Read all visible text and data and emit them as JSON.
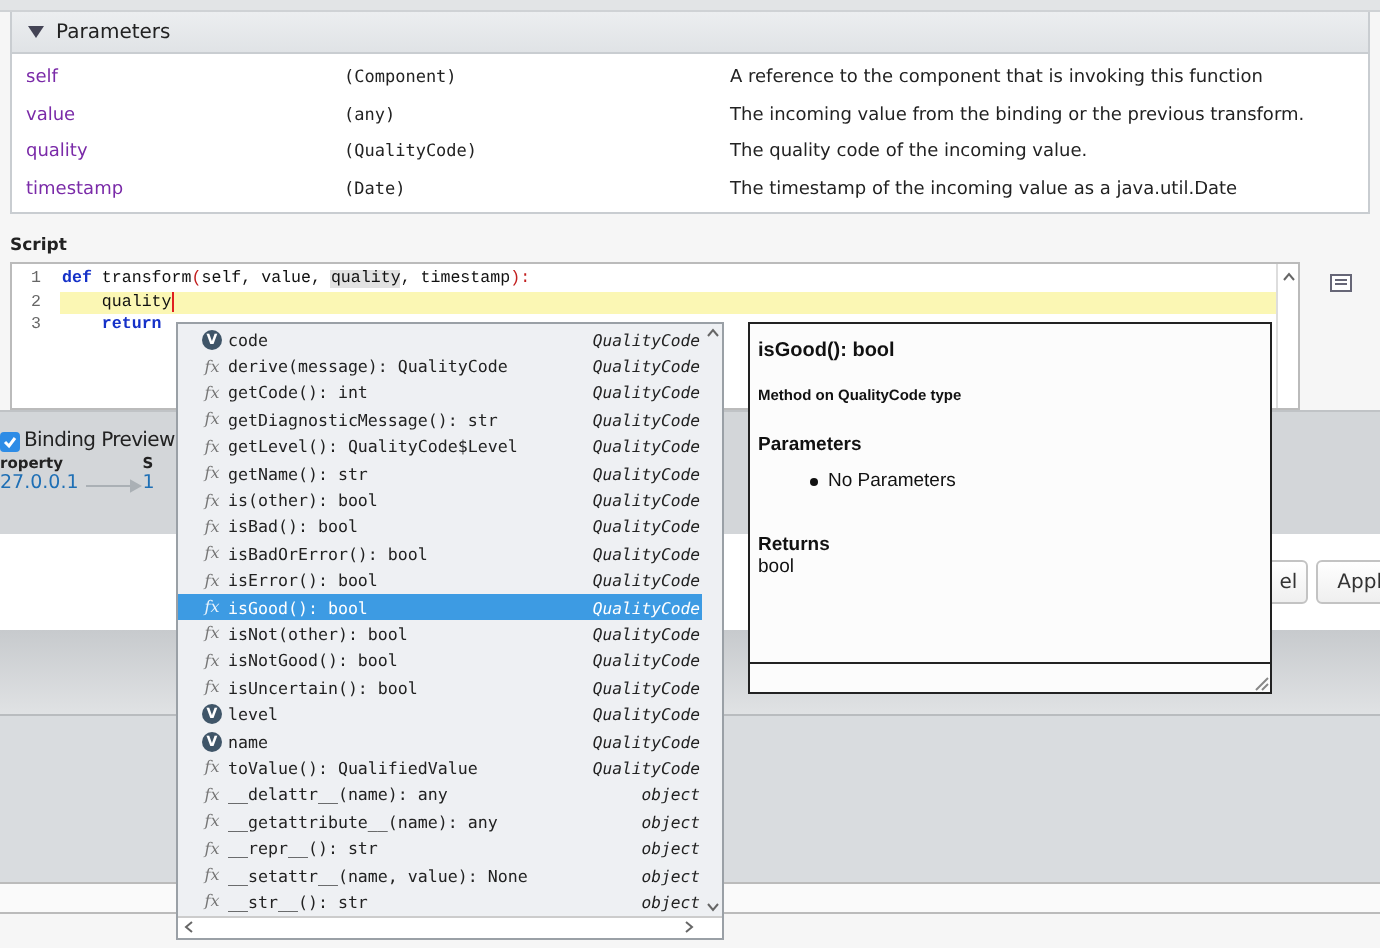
{
  "parameters": {
    "title": "Parameters",
    "expanded": true,
    "rows": [
      {
        "name": "self",
        "type": "(Component)",
        "description": "A reference to the component that is invoking this function"
      },
      {
        "name": "value",
        "type": "(any)",
        "description": "The incoming value from the binding or the previous transform."
      },
      {
        "name": "quality",
        "type": "(QualityCode)",
        "description": "The quality code of the incoming value."
      },
      {
        "name": "timestamp",
        "type": "(Date)",
        "description": "The timestamp of the incoming value as a java.util.Date"
      }
    ]
  },
  "script": {
    "label": "Script",
    "lines": [
      {
        "number": "1",
        "current": false,
        "tokens": [
          {
            "text": "def",
            "kind": "keyword"
          },
          {
            "text": " transform",
            "kind": "plain"
          },
          {
            "text": "(",
            "kind": "punct"
          },
          {
            "text": "self, value, ",
            "kind": "plain"
          },
          {
            "text": "quality",
            "kind": "occurrence"
          },
          {
            "text": ", timestamp",
            "kind": "plain"
          },
          {
            "text": "):",
            "kind": "punct"
          }
        ]
      },
      {
        "number": "2",
        "current": true,
        "tokens": [
          {
            "text": "    quality",
            "kind": "plain"
          }
        ]
      },
      {
        "number": "3",
        "current": false,
        "tokens": [
          {
            "text": "    return",
            "kind": "keyword"
          }
        ]
      }
    ]
  },
  "binding_preview": {
    "label": "Binding Preview",
    "checked": true,
    "column_1_label": "roperty",
    "column_1_value": "27.0.0.1",
    "column_2_label": "S",
    "column_2_value": "1"
  },
  "buttons": [
    "el",
    "Appl"
  ],
  "completion": {
    "items": [
      {
        "kind": "field",
        "icon": "V",
        "label": "code",
        "type": "QualityCode",
        "selected": false
      },
      {
        "kind": "method",
        "icon": "fx",
        "label": "derive(message): QualityCode",
        "type": "QualityCode",
        "selected": false
      },
      {
        "kind": "method",
        "icon": "fx",
        "label": "getCode(): int",
        "type": "QualityCode",
        "selected": false
      },
      {
        "kind": "method",
        "icon": "fx",
        "label": "getDiagnosticMessage(): str",
        "type": "QualityCode",
        "selected": false
      },
      {
        "kind": "method",
        "icon": "fx",
        "label": "getLevel(): QualityCode$Level",
        "type": "QualityCode",
        "selected": false
      },
      {
        "kind": "method",
        "icon": "fx",
        "label": "getName(): str",
        "type": "QualityCode",
        "selected": false
      },
      {
        "kind": "method",
        "icon": "fx",
        "label": "is(other): bool",
        "type": "QualityCode",
        "selected": false
      },
      {
        "kind": "method",
        "icon": "fx",
        "label": "isBad(): bool",
        "type": "QualityCode",
        "selected": false
      },
      {
        "kind": "method",
        "icon": "fx",
        "label": "isBadOrError(): bool",
        "type": "QualityCode",
        "selected": false
      },
      {
        "kind": "method",
        "icon": "fx",
        "label": "isError(): bool",
        "type": "QualityCode",
        "selected": false
      },
      {
        "kind": "method",
        "icon": "fx",
        "label": "isGood(): bool",
        "type": "QualityCode",
        "selected": true
      },
      {
        "kind": "method",
        "icon": "fx",
        "label": "isNot(other): bool",
        "type": "QualityCode",
        "selected": false
      },
      {
        "kind": "method",
        "icon": "fx",
        "label": "isNotGood(): bool",
        "type": "QualityCode",
        "selected": false
      },
      {
        "kind": "method",
        "icon": "fx",
        "label": "isUncertain(): bool",
        "type": "QualityCode",
        "selected": false
      },
      {
        "kind": "field",
        "icon": "V",
        "label": "level",
        "type": "QualityCode",
        "selected": false
      },
      {
        "kind": "field",
        "icon": "V",
        "label": "name",
        "type": "QualityCode",
        "selected": false
      },
      {
        "kind": "method",
        "icon": "fx",
        "label": "toValue(): QualifiedValue",
        "type": "QualityCode",
        "selected": false
      },
      {
        "kind": "method",
        "icon": "fx",
        "label": "__delattr__(name): any",
        "type": "object",
        "selected": false
      },
      {
        "kind": "method",
        "icon": "fx",
        "label": "__getattribute__(name): any",
        "type": "object",
        "selected": false
      },
      {
        "kind": "method",
        "icon": "fx",
        "label": "__repr__(): str",
        "type": "object",
        "selected": false
      },
      {
        "kind": "method",
        "icon": "fx",
        "label": "__setattr__(name, value): None",
        "type": "object",
        "selected": false
      },
      {
        "kind": "method",
        "icon": "fx",
        "label": "__str__(): str",
        "type": "object",
        "selected": false
      }
    ]
  },
  "doc": {
    "title": "isGood(): bool",
    "subtitle": "Method on QualityCode type",
    "parameters_heading": "Parameters",
    "parameters": [
      "No Parameters"
    ],
    "returns_heading": "Returns",
    "returns": "bool"
  }
}
